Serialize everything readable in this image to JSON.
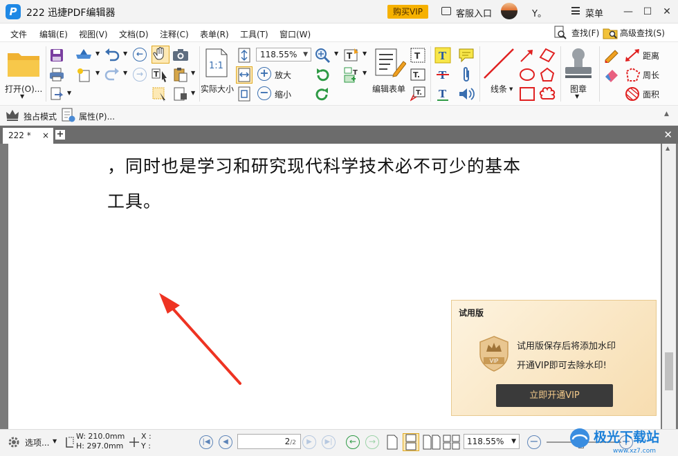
{
  "app": {
    "title": "222 迅捷PDF编辑器",
    "logo_letter": "P",
    "vip_button": "购买VIP",
    "customer_service": "客服入口",
    "user_name": "Y。",
    "menu_label": "菜单",
    "window_controls": {
      "minimize": "—",
      "maximize": "☐",
      "close": "✕"
    }
  },
  "menubar": {
    "items": [
      "文件",
      "编辑(E)",
      "视图(V)",
      "文档(D)",
      "注释(C)",
      "表单(R)",
      "工具(T)",
      "窗口(W)"
    ],
    "find": "查找(F)",
    "advanced_find": "高级查找(S)"
  },
  "toolbar": {
    "open": "打开(O)...",
    "actual_size": "实际大小",
    "actual_size_icon_text": "1:1",
    "zoom_value": "118.55%",
    "zoom_in": "放大",
    "zoom_out": "缩小",
    "edit_form": "编辑表单",
    "line": "线条",
    "stamp": "图章",
    "distance": "距离",
    "perimeter": "周长",
    "area": "面积"
  },
  "toolbar2": {
    "exclusive_mode": "独占模式",
    "properties": "属性(P)..."
  },
  "tabs": {
    "active": "222 *",
    "close": "×",
    "add": "+",
    "close_all": "✕"
  },
  "document": {
    "lines": [
      "，同时也是学习和研究现代科学技术必不可少的基本",
      "工具。"
    ]
  },
  "trial_popup": {
    "title": "试用版",
    "line1": "试用版保存后将添加水印",
    "line2": "开通VIP即可去除水印!",
    "badge": "VIP",
    "button": "立即开通VIP"
  },
  "statusbar": {
    "options": "选项...",
    "width": "W: 210.0mm",
    "height": "H: 297.0mm",
    "x": "X :",
    "y": "Y :",
    "page_current": "2",
    "page_total": "/2",
    "zoom_value": "118.55%"
  },
  "watermark": {
    "text": "极光下载站",
    "url": "www.xz7.com"
  },
  "colors": {
    "vip": "#f6b100",
    "accent_blue": "#3a6fb0",
    "annotation_red": "#e02020",
    "arrow_red": "#ee3322"
  }
}
